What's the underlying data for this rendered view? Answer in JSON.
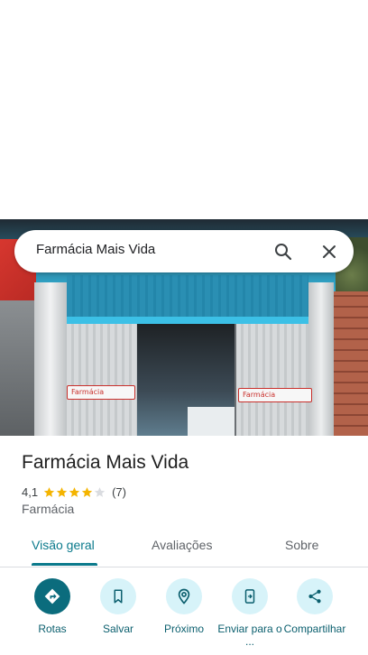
{
  "search": {
    "query": "Farmácia Mais Vida"
  },
  "photo": {
    "sign_left": "Farmácia",
    "sign_right": "Farmácia"
  },
  "place": {
    "name": "Farmácia Mais Vida",
    "rating": "4,1",
    "stars_filled": 4,
    "stars_total": 5,
    "review_count": "(7)",
    "category": "Farmácia"
  },
  "tabs": [
    {
      "label": "Visão geral",
      "active": true
    },
    {
      "label": "Avaliações",
      "active": false
    },
    {
      "label": "Sobre",
      "active": false
    }
  ],
  "actions": [
    {
      "label": "Rotas",
      "icon": "directions-icon"
    },
    {
      "label": "Salvar",
      "icon": "bookmark-icon"
    },
    {
      "label": "Próximo",
      "icon": "nearby-icon"
    },
    {
      "label": "Enviar para o ...",
      "icon": "send-to-phone-icon"
    },
    {
      "label": "Compartilhar",
      "icon": "share-icon"
    }
  ],
  "colors": {
    "accent": "#0b7a8c",
    "action_bg": "#d7f3f9",
    "star": "#f4b400"
  }
}
